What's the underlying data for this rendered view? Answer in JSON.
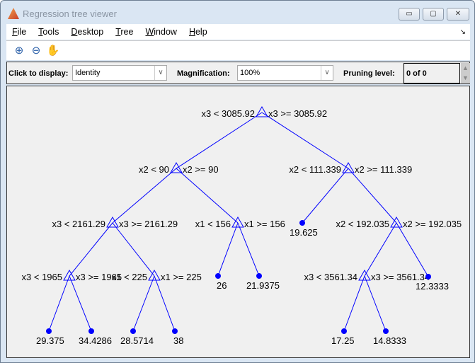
{
  "window": {
    "title": "Regression tree viewer",
    "min": "▭",
    "max": "▢",
    "close": "✕"
  },
  "menu": [
    "File",
    "Tools",
    "Desktop",
    "Tree",
    "Window",
    "Help"
  ],
  "menu_dock_icon": "dock-arrow-icon",
  "toolbar": [
    {
      "icon": "zoom-in-icon",
      "glyph": "⊕"
    },
    {
      "icon": "zoom-out-icon",
      "glyph": "⊖"
    },
    {
      "icon": "pan-hand-icon",
      "glyph": "✋"
    }
  ],
  "controls": {
    "display_label": "Click to display:",
    "display_value": "Identity",
    "magnification_label": "Magnification:",
    "magnification_value": "100%",
    "pruning_label": "Pruning level:",
    "pruning_value": "0 of 0"
  },
  "tree_color": "#0000ff",
  "tree": [
    {
      "id": 0,
      "type": "branch",
      "left": "x3 < 3085.92",
      "right": "x3 >= 3085.92",
      "children": [
        1,
        2
      ]
    },
    {
      "id": 1,
      "type": "branch",
      "left": "x2 < 90",
      "right": "x2 >= 90",
      "children": [
        3,
        4
      ]
    },
    {
      "id": 2,
      "type": "branch",
      "left": "x2 < 111.339",
      "right": "x2 >= 111.339",
      "children": [
        5,
        6
      ]
    },
    {
      "id": 3,
      "type": "branch",
      "left": "x3 < 2161.29",
      "right": "x3 >= 2161.29",
      "children": [
        7,
        8
      ]
    },
    {
      "id": 4,
      "type": "branch",
      "left": "x1 < 156",
      "right": "x1 >= 156",
      "children": [
        9,
        10
      ]
    },
    {
      "id": 5,
      "type": "leaf",
      "value": "19.625"
    },
    {
      "id": 6,
      "type": "branch",
      "left": "x2 < 192.035",
      "right": "x2 >= 192.035",
      "children": [
        11,
        12
      ]
    },
    {
      "id": 7,
      "type": "branch",
      "left": "x3 < 1965",
      "right": "x3 >= 1965",
      "children": [
        13,
        14
      ]
    },
    {
      "id": 8,
      "type": "branch",
      "left": "x1 < 225",
      "right": "x1 >= 225",
      "children": [
        15,
        16
      ]
    },
    {
      "id": 9,
      "type": "leaf",
      "value": "26"
    },
    {
      "id": 10,
      "type": "leaf",
      "value": "21.9375"
    },
    {
      "id": 11,
      "type": "branch",
      "left": "x3 < 3561.34",
      "right": "x3 >= 3561.34",
      "children": [
        17,
        18
      ]
    },
    {
      "id": 12,
      "type": "leaf",
      "value": "12.3333"
    },
    {
      "id": 13,
      "type": "leaf",
      "value": "29.375"
    },
    {
      "id": 14,
      "type": "leaf",
      "value": "34.4286"
    },
    {
      "id": 15,
      "type": "leaf",
      "value": "28.5714"
    },
    {
      "id": 16,
      "type": "leaf",
      "value": "38"
    },
    {
      "id": 17,
      "type": "leaf",
      "value": "17.25"
    },
    {
      "id": 18,
      "type": "leaf",
      "value": "14.8333"
    }
  ]
}
